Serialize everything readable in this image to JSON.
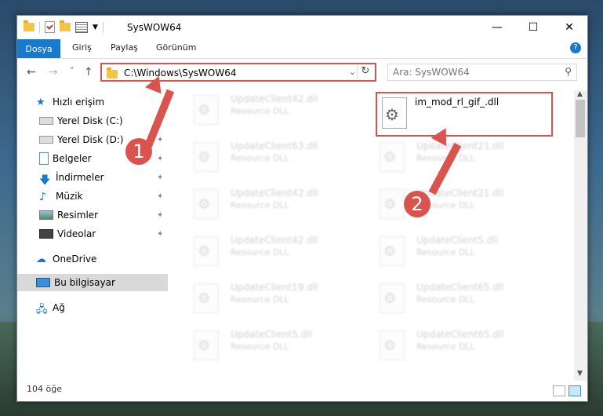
{
  "window": {
    "title": "SysWOW64",
    "controls": {
      "minimize": "—",
      "maximize": "☐",
      "close": "✕"
    }
  },
  "ribbon": {
    "tabs": [
      "Dosya",
      "Giriş",
      "Paylaş",
      "Görünüm"
    ],
    "help": "?"
  },
  "nav": {
    "back": "←",
    "forward": "→",
    "recent": "˅",
    "up": "↑",
    "address": "C:\\Windows\\SysWOW64",
    "address_dropdown": "⌄",
    "refresh": "↻",
    "search_placeholder": "Ara: SysWOW64",
    "search_icon": "search-icon"
  },
  "sidebar": {
    "items": [
      {
        "label": "Hızlı erişim",
        "icon": "star-icon"
      },
      {
        "label": "Yerel Disk (C:)",
        "icon": "drive-icon",
        "pinned": true
      },
      {
        "label": "Yerel Disk (D:)",
        "icon": "drive-icon",
        "pinned": true
      },
      {
        "label": "Belgeler",
        "icon": "documents-icon",
        "pinned": true
      },
      {
        "label": "İndirmeler",
        "icon": "download-icon",
        "pinned": true
      },
      {
        "label": "Müzik",
        "icon": "music-icon",
        "pinned": true
      },
      {
        "label": "Resimler",
        "icon": "pictures-icon",
        "pinned": true
      },
      {
        "label": "Videolar",
        "icon": "videos-icon",
        "pinned": true
      },
      {
        "label": "OneDrive",
        "icon": "cloud-icon"
      },
      {
        "label": "Bu bilgisayar",
        "icon": "computer-icon",
        "selected": true
      },
      {
        "label": "Ağ",
        "icon": "network-icon"
      }
    ],
    "pin_glyph": "📌"
  },
  "files": {
    "highlighted": {
      "name": "im_mod_rl_gif_.dll"
    },
    "left_column": [
      {
        "name": "UpdateClient42.dll",
        "type": "Resource DLL"
      },
      {
        "name": "UpdateClient63.dll",
        "type": "Resource DLL"
      },
      {
        "name": "UpdateClient42.dll",
        "type": "Resource DLL"
      },
      {
        "name": "UpdateClient42.dll",
        "type": "Resource DLL"
      },
      {
        "name": "UpdateClient19.dll",
        "type": "Resource DLL"
      },
      {
        "name": "UpdateClient5.dll",
        "type": "Resource DLL"
      }
    ],
    "right_column": [
      {
        "name": "UpdateClient21.dll",
        "type": "Resource DLL"
      },
      {
        "name": "UpdateClient21.dll",
        "type": "Resource DLL"
      },
      {
        "name": "UpdateClient5.dll",
        "type": "Resource DLL"
      },
      {
        "name": "UpdateClient65.dll",
        "type": "Resource DLL"
      },
      {
        "name": "UpdateClient65.dll",
        "type": "Resource DLL"
      }
    ]
  },
  "status": {
    "count": "104 öğe"
  },
  "annotations": {
    "step1": "1",
    "step2": "2",
    "color": "#d9534f"
  }
}
